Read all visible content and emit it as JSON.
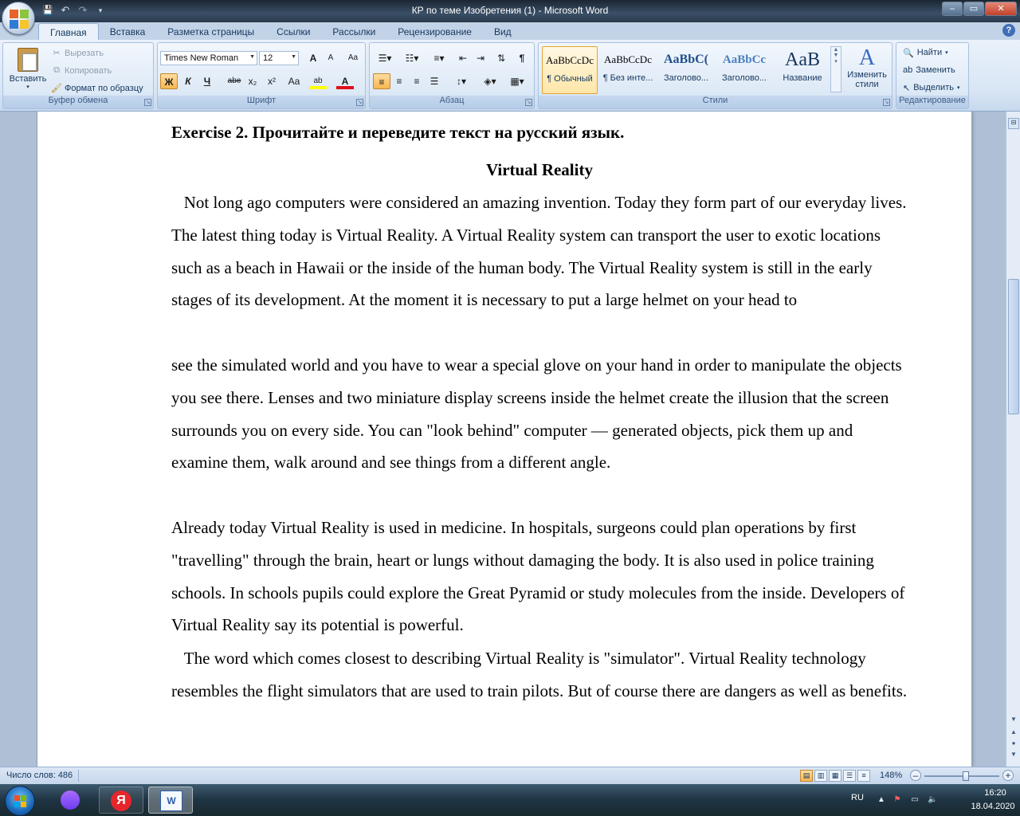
{
  "window": {
    "title": "КР по теме Изобретения (1) - Microsoft Word",
    "controls": {
      "minimize": "–",
      "maximize": "▭",
      "close": "✕"
    }
  },
  "quick_access": {
    "save": "💾",
    "undo": "↶",
    "redo": "↷",
    "customize": "▾"
  },
  "tabs": [
    {
      "label": "Главная"
    },
    {
      "label": "Вставка"
    },
    {
      "label": "Разметка страницы"
    },
    {
      "label": "Ссылки"
    },
    {
      "label": "Рассылки"
    },
    {
      "label": "Рецензирование"
    },
    {
      "label": "Вид"
    }
  ],
  "ribbon": {
    "clipboard": {
      "label": "Буфер обмена",
      "paste": "Вставить",
      "cut": "Вырезать",
      "copy": "Копировать",
      "format_painter": "Формат по образцу"
    },
    "font": {
      "label": "Шрифт",
      "font_name": "Times New Roman",
      "font_size": "12",
      "grow": "A",
      "shrink": "A",
      "clear": "Aa",
      "bold": "Ж",
      "italic": "К",
      "underline": "Ч",
      "strike": "abe",
      "subscript": "x₂",
      "superscript": "x²",
      "change_case": "Aa",
      "highlight": "ab",
      "font_color": "A"
    },
    "paragraph": {
      "label": "Абзац",
      "pilcrow": "¶"
    },
    "styles": {
      "label": "Стили",
      "items": [
        {
          "sample": "AaBbCcDc",
          "name": "¶ Обычный"
        },
        {
          "sample": "AaBbCcDc",
          "name": "¶ Без инте..."
        },
        {
          "sample": "AaBbC(",
          "name": "Заголово..."
        },
        {
          "sample": "AaBbCc",
          "name": "Заголово..."
        },
        {
          "sample": "AaB",
          "name": "Название"
        }
      ],
      "change_styles": "Изменить стили"
    },
    "editing": {
      "label": "Редактирование",
      "find": "Найти",
      "replace": "Заменить",
      "select": "Выделить"
    }
  },
  "document": {
    "exercise_heading": "Exercise 2. Прочитайте и переведите текст на русский язык.",
    "title": "Virtual Reality",
    "paragraphs": [
      "   Not long ago computers were considered an amazing invention. Today they form part of our everyday lives. The latest thing today is Virtual Reality. A Virtual Reality system can transport the user to exotic locations such as a beach in Hawaii or the inside of the human body. The Virtual Reality system is still in the early stages of its development. At the moment it is necessary to put a large helmet on your head to",
      "see the simulated world and you have to wear a special glove on your hand in order to manipulate the objects you see there. Lenses and two miniature display screens inside the helmet create the illusion that the screen surrounds you on every side. You can \"look behind\" computer — generated objects, pick them up and examine them, walk around and see things from a different angle.",
      "Already today Virtual Reality is used in medicine. In hospitals, surgeons could plan operations by first \"travelling\" through the brain, heart or lungs without damaging the body. It is also used in police training schools. In schools pupils could explore the Great Pyramid or study molecules from the inside. Developers of Virtual Reality say its potential is powerful.",
      "   The word which comes closest to describing Virtual Reality is \"simulator\". Virtual Reality technology resembles the flight simulators that are used to train pilots. But of course there are dangers as well as benefits."
    ]
  },
  "statusbar": {
    "word_count": "Число слов: 486",
    "zoom": "148%",
    "zoom_minus": "–",
    "zoom_plus": "+"
  },
  "taskbar": {
    "language": "RU",
    "time": "16:20",
    "date": "18.04.2020",
    "yandex_letter": "Я",
    "word_letter": "W"
  },
  "colors": {
    "ribbon_bg": "#dbe7f5",
    "titlebar": "#2a3a4c",
    "accent_pressed": "#f7b74f",
    "font_color_bar": "#e0101a",
    "highlight_bar": "#ffff00"
  }
}
